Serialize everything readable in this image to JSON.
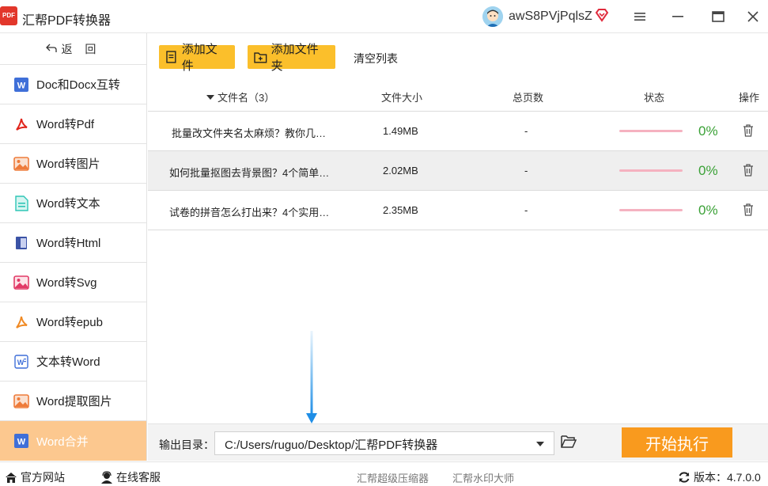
{
  "app": {
    "title": "汇帮PDF转换器",
    "logo_text": "PDF"
  },
  "user": {
    "name": "awS8PVjPqlsZ"
  },
  "sidebar": {
    "back_label": "返 回",
    "items": [
      {
        "label": "Doc和Docx互转",
        "icon": "word-icon"
      },
      {
        "label": "Word转Pdf",
        "icon": "pdf-icon"
      },
      {
        "label": "Word转图片",
        "icon": "image-icon"
      },
      {
        "label": "Word转文本",
        "icon": "text-file-icon"
      },
      {
        "label": "Word转Html",
        "icon": "html-icon"
      },
      {
        "label": "Word转Svg",
        "icon": "svg-image-icon"
      },
      {
        "label": "Word转epub",
        "icon": "epub-icon"
      },
      {
        "label": "文本转Word",
        "icon": "word-outline-icon"
      },
      {
        "label": "Word提取图片",
        "icon": "image-extract-icon"
      },
      {
        "label": "Word合并",
        "icon": "word-icon",
        "active": true
      }
    ]
  },
  "toolbar": {
    "add_file": "添加文件",
    "add_folder": "添加文件夹",
    "clear_list": "清空列表"
  },
  "table": {
    "headers": {
      "name": "文件名（3）",
      "size": "文件大小",
      "pages": "总页数",
      "status": "状态",
      "action": "操作"
    },
    "rows": [
      {
        "name": "批量改文件夹名太麻烦？教你几…",
        "size": "1.49MB",
        "pages": "-",
        "progress": "0%"
      },
      {
        "name": "如何批量抠图去背景图？4个简单…",
        "size": "2.02MB",
        "pages": "-",
        "progress": "0%"
      },
      {
        "name": "试卷的拼音怎么打出来？4个实用…",
        "size": "2.35MB",
        "pages": "-",
        "progress": "0%"
      }
    ]
  },
  "output": {
    "label": "输出目录：",
    "path": "C:/Users/ruguo/Desktop/汇帮PDF转换器",
    "start": "开始执行"
  },
  "footer": {
    "website": "官方网站",
    "support": "在线客服",
    "compressor": "汇帮超级压缩器",
    "watermark": "汇帮水印大师",
    "version_label": "版本：",
    "version": "4.7.0.0"
  },
  "colors": {
    "accent": "#fbbf2b",
    "start": "#f99a1e",
    "active_side": "#fcc88f",
    "progress_ok": "#3aa136"
  }
}
